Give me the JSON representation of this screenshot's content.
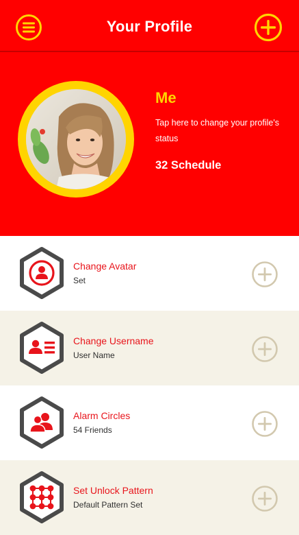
{
  "header": {
    "title": "Your Profile",
    "menu_icon": "menu-icon",
    "add_icon": "plus-circle-icon"
  },
  "profile": {
    "name": "Me",
    "status": "Tap here to change your profile's status",
    "schedule": "32 Schedule"
  },
  "items": [
    {
      "title": "Change Avatar",
      "subtitle": "Set",
      "icon": "avatar-icon"
    },
    {
      "title": "Change Username",
      "subtitle": "User Name",
      "icon": "id-card-icon"
    },
    {
      "title": "Alarm Circles",
      "subtitle": "54 Friends",
      "icon": "group-icon"
    },
    {
      "title": "Set Unlock Pattern",
      "subtitle": "Default Pattern Set",
      "icon": "pattern-grid-icon"
    }
  ],
  "colors": {
    "primary_red": "#ff0000",
    "accent_yellow": "#ffd400",
    "item_title_red": "#e8141b",
    "alt_row_bg": "#f5f2e7",
    "hex_outline": "#4a4a4a",
    "add_icon_muted": "#d2c8ae"
  }
}
